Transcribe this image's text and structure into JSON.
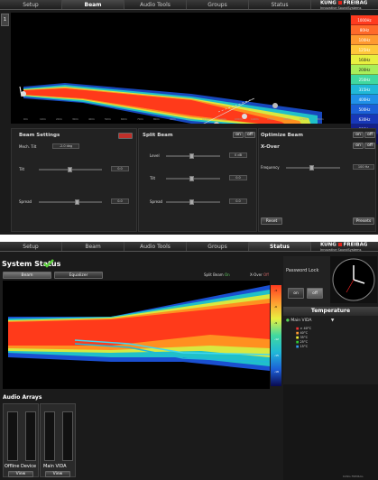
{
  "nav": {
    "tabs": [
      "Setup",
      "Beam",
      "Audio Tools",
      "Groups",
      "Status"
    ],
    "logo_brand": "KUNG",
    "logo_brand2": "FREIBAG",
    "logo_tagline": "Innovative SoundSystems"
  },
  "beam_view": {
    "page_tab": "1",
    "colorbar_labels": [
      "1000Hz",
      "80Hz",
      "100Hz",
      "125Hz",
      "160Hz",
      "200Hz",
      "250Hz",
      "315Hz",
      "400Hz",
      "500Hz",
      "630Hz",
      "800Hz",
      "1kHz"
    ],
    "colorbar_colors": [
      "#ff3b1f",
      "#ff6a2a",
      "#ff9a30",
      "#ffc83a",
      "#e8f040",
      "#a8ee5a",
      "#40d8a0",
      "#20b8d8",
      "#2090e8",
      "#1c60d8",
      "#1838b8",
      "#14208a",
      "#0a0a50"
    ],
    "x_ticks": [
      "0m",
      "10m",
      "20m",
      "30m",
      "40m",
      "50m",
      "60m",
      "70m",
      "80m",
      "90m",
      "100m",
      "110m",
      "120m",
      "130m",
      "140m",
      "150m",
      "160m",
      "170m",
      "180m"
    ],
    "beam_settings": {
      "title": "Beam Settings",
      "rows": [
        {
          "label": "Mech. Tilt",
          "value": "-2.0 deg"
        },
        {
          "label": "Tilt",
          "value": "0.0"
        },
        {
          "label": "Spread",
          "value": "0.0"
        }
      ]
    },
    "split_beam": {
      "title": "Split Beam",
      "on": "on",
      "off": "off",
      "rows": [
        {
          "label": "Level",
          "value": "0 dB"
        },
        {
          "label": "Tilt",
          "value": "0.0"
        },
        {
          "label": "Spread",
          "value": "0.0"
        }
      ]
    },
    "optimize_beam": {
      "title": "Optimize Beam",
      "on": "on",
      "off": "off",
      "xover_title": "X-Over",
      "freq_label": "Frequency",
      "freq_value": "100 Hz",
      "reset": "Reset",
      "presets": "Presets"
    }
  },
  "status_view": {
    "title": "System Status",
    "sub_tabs": [
      "Beam",
      "Equalizer"
    ],
    "split_beam_label": "Split Beam",
    "split_beam_state": "On",
    "xover_label": "X-Over",
    "xover_state": "Off",
    "colorbar_ticks": [
      "-3",
      "-6",
      "-9",
      "-12",
      "-15",
      "-18"
    ],
    "password_lock": {
      "title": "Password Lock",
      "on": "on",
      "off": "off"
    },
    "temperature": {
      "title": "Temperature",
      "group": "Main VIDA",
      "legend": [
        "> 40°C",
        "40°C",
        "35°C",
        "25°C",
        "15°C"
      ]
    },
    "audio_arrays": {
      "title": "Audio Arrays",
      "devices": [
        {
          "name": "Offline Device",
          "button": "View"
        },
        {
          "name": "Main VIDA",
          "button": "View"
        }
      ]
    },
    "footer_brand": "KUNG FREIBAG"
  }
}
